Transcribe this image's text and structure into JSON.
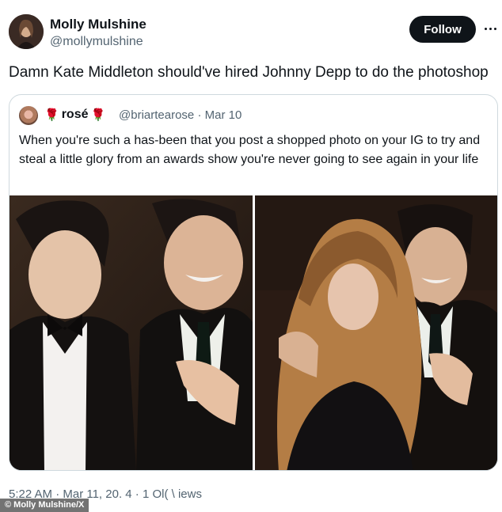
{
  "author": {
    "display_name": "Molly Mulshine",
    "handle": "@mollymulshine",
    "follow_label": "Follow"
  },
  "tweet": {
    "text": "Damn Kate Middleton should've hired Johnny Depp to do the photoshop"
  },
  "quoted": {
    "display_name": "rosé",
    "name_emoji_left": "🌹",
    "name_emoji_right": "🌹",
    "handle": "@briartearose",
    "separator": "·",
    "date": "Mar 10",
    "text": "When you're such a has-been that you post a shopped photo on your IG to try and steal a little glory from an awards show you're never going to see again in your life"
  },
  "footer": {
    "meta": "5:22 AM · Mar 11, 20. 4 · 1 Ol( \\ iews"
  },
  "watermark": "© Molly Mulshine/X",
  "colors": {
    "text_primary": "#0f1419",
    "text_secondary": "#536471",
    "border": "#cfd9de",
    "follow_bg": "#0f1419"
  }
}
